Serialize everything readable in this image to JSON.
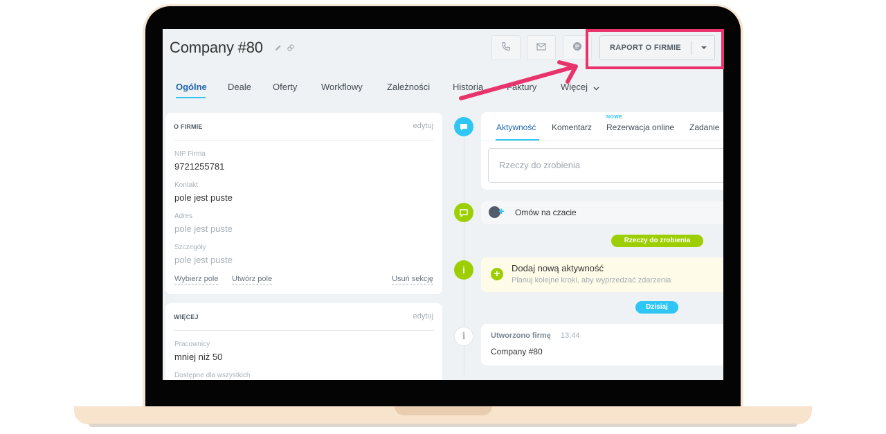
{
  "header": {
    "title": "Company #80",
    "report_button": "RAPORT O FIRMIE"
  },
  "tabs": [
    "Ogólne",
    "Deale",
    "Oferty",
    "Workflowy",
    "Zależności",
    "Historia",
    "Faktury",
    "Więcej"
  ],
  "about_card": {
    "heading": "O FIRMIE",
    "edit": "edytuj",
    "fields": [
      {
        "label": "NIP Firma",
        "value": "9721255781"
      },
      {
        "label": "Kontakt",
        "value": "pole jest puste"
      },
      {
        "label": "Adres",
        "value": "pole jest puste"
      },
      {
        "label": "Szczegóły",
        "value": "pole jest puste"
      }
    ],
    "links": {
      "select_field": "Wybierz pole",
      "create_field": "Utwórz pole",
      "delete_section": "Usuń sekcję"
    }
  },
  "more_card": {
    "heading": "WIĘCEJ",
    "edit": "edytuj",
    "fields": [
      {
        "label": "Pracownicy",
        "value": "mniej niż 50"
      },
      {
        "label": "Dostępne dla wszystkich",
        "value": ""
      }
    ]
  },
  "editor": {
    "tabs": [
      "Aktywność",
      "Komentarz",
      "Rezerwacja online",
      "Zadanie"
    ],
    "new_badge": "NOWE",
    "placeholder": "Rzeczy do zrobienia"
  },
  "timeline": {
    "chat_label": "Omów na czacie",
    "todo_pill": "Rzeczy do zrobienia",
    "add_activity_title": "Dodaj nową aktywność",
    "add_activity_sub": "Planuj kolejne kroki, aby wyprzedzać zdarzenia",
    "today_pill": "Dzisiaj",
    "created_title": "Utworzono firmę",
    "created_time": "13:44",
    "created_body": "Company #80"
  },
  "colors": {
    "accent_blue": "#2fc6f6",
    "active_tab": "#2067b0",
    "green": "#9dcf00",
    "highlight": "#e8336c",
    "laptop": "#f6e6d4"
  }
}
